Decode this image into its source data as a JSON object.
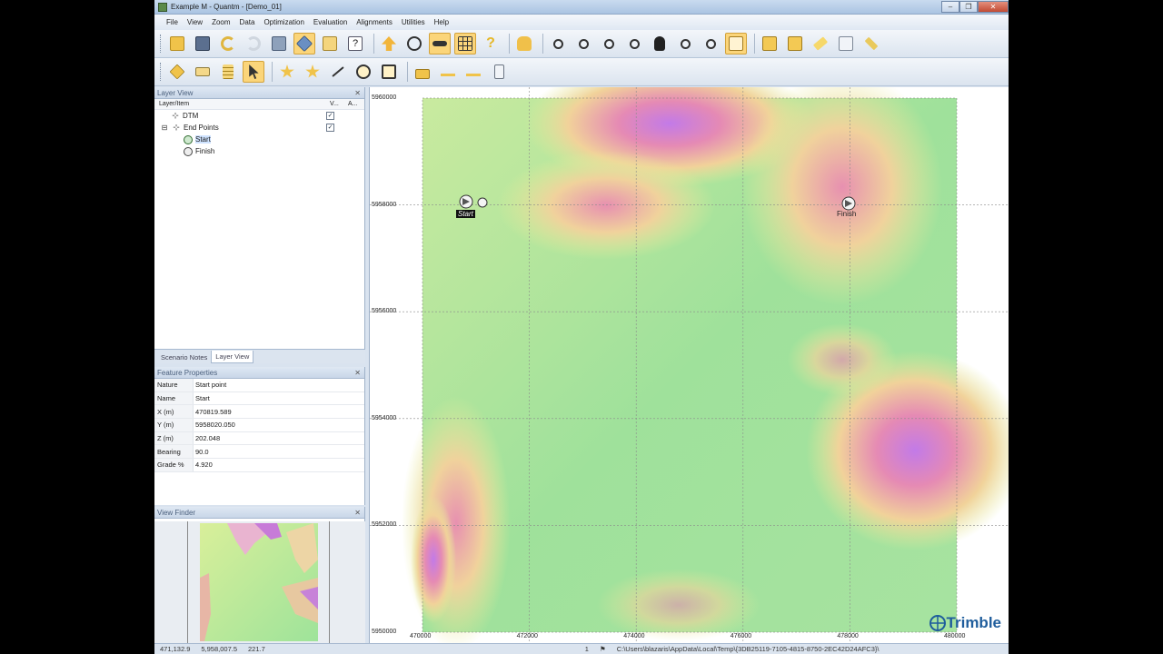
{
  "window": {
    "title": "Example M - Quantm - [Demo_01]"
  },
  "menu": [
    "File",
    "View",
    "Zoom",
    "Data",
    "Optimization",
    "Evaluation",
    "Alignments",
    "Utilities",
    "Help"
  ],
  "toolbar1": [
    "open-folder-icon",
    "save-icon",
    "undo-icon",
    "redo-icon",
    "scenario-icon",
    "layers-icon",
    "document-icon",
    "help-dialog-icon",
    "arrow-up-icon",
    "eye-refresh-icon",
    "key-icon",
    "grid-icon",
    "question-icon",
    "hand-pointer-icon",
    "zoom-icon",
    "zoom-in-icon",
    "zoom-out-icon",
    "zoom-window-icon",
    "pan-hand-icon",
    "zoom-extents-icon",
    "zoom-previous-icon",
    "frame-icon",
    "import-icon",
    "export-icon",
    "pencil-icon",
    "screen-icon",
    "edit-tool-icon"
  ],
  "toolbar2": [
    "cube-icon",
    "truck-icon",
    "table-icon",
    "select-arrow-icon",
    "star-add-icon",
    "move-points-icon",
    "line-icon",
    "circle-icon",
    "rect-icon",
    "lock-icon",
    "node-a-icon",
    "node-b-icon",
    "report-icon"
  ],
  "layer_view": {
    "title": "Layer View",
    "columns": [
      "Layer/Item",
      "V...",
      "A..."
    ],
    "items": [
      {
        "label": "DTM",
        "visible": true,
        "level": 0
      },
      {
        "label": "End Points",
        "visible": true,
        "level": 0
      },
      {
        "label": "Start",
        "level": 1
      },
      {
        "label": "Finish",
        "level": 1
      }
    ]
  },
  "tabs": [
    "Scenario Notes",
    "Layer View"
  ],
  "feature_properties": {
    "title": "Feature Properties",
    "rows": [
      {
        "k": "Nature",
        "v": "Start point"
      },
      {
        "k": "Name",
        "v": "Start"
      },
      {
        "k": "X (m)",
        "v": "470819.589"
      },
      {
        "k": "Y (m)",
        "v": "5958020.050"
      },
      {
        "k": "Z (m)",
        "v": "202.048"
      },
      {
        "k": "Bearing",
        "v": "90.0"
      },
      {
        "k": "Grade %",
        "v": "4.920"
      }
    ]
  },
  "view_finder": {
    "title": "View Finder"
  },
  "map": {
    "y_labels": [
      "5960000",
      "5958000",
      "5956000",
      "5954000",
      "5952000",
      "5950000"
    ],
    "x_labels": [
      "470000",
      "472000",
      "474000",
      "476000",
      "478000",
      "480000"
    ],
    "markers": {
      "start": "Start",
      "finish": "Finish"
    },
    "brand": "Trimble"
  },
  "status": {
    "coords": "471,132.9",
    "coord_y": "5,958,007.5",
    "elev": "221.7",
    "page": "1",
    "path": "C:\\Users\\blazaris\\AppData\\Local\\Temp\\{3DB25119-7105-4815-8750-2EC42D24AFC3}\\"
  },
  "colors": {
    "accent": "#fbd57a",
    "terrain_low": "#8fd88a",
    "terrain_mid": "#e8e08a",
    "terrain_high": "#d96fd8"
  }
}
